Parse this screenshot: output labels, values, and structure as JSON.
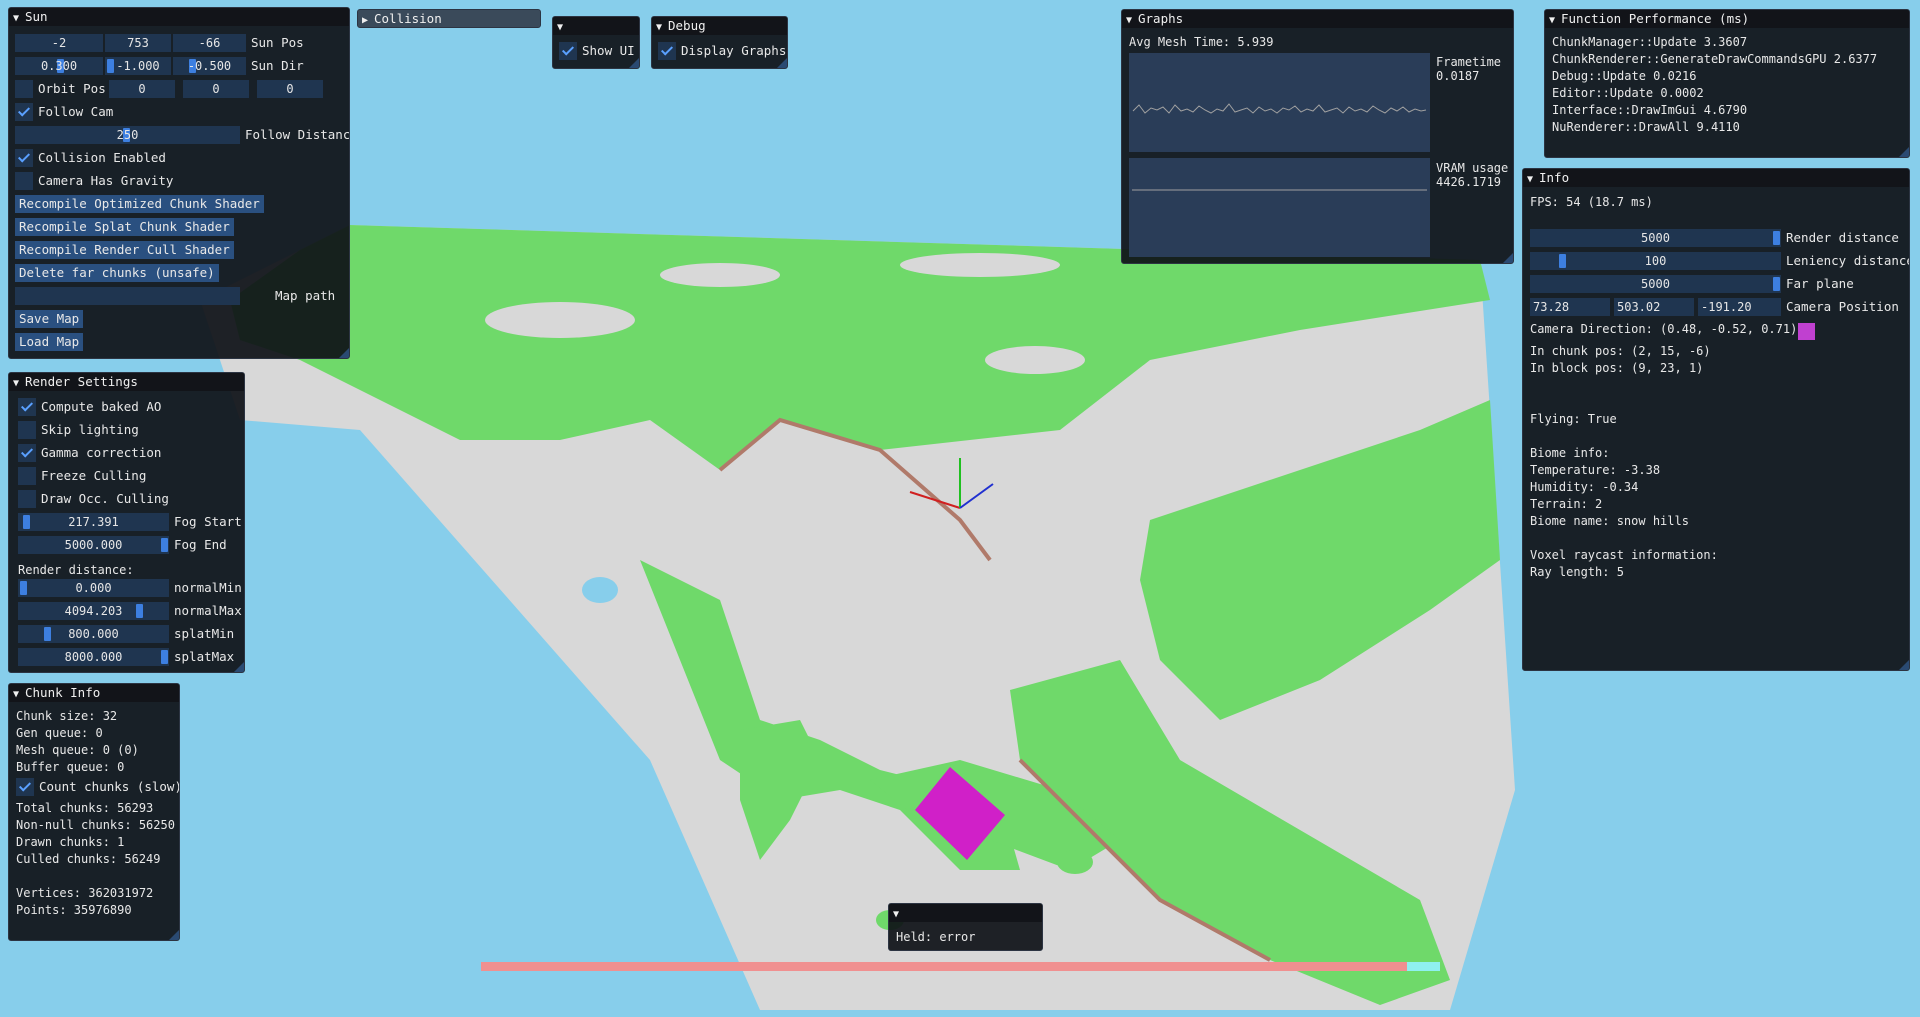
{
  "sun": {
    "title": "Sun",
    "pos": [
      "-2",
      "753",
      "-66"
    ],
    "pos_label": "Sun Pos",
    "dir": [
      "0.300",
      "-1.000",
      "-0.500"
    ],
    "dir_label": "Sun Dir",
    "orbit_label": "Orbit Pos",
    "orbit": [
      "0",
      "0",
      "0"
    ],
    "follow_cam": "Follow Cam",
    "follow_distance": "250",
    "follow_distance_label": "Follow Distance",
    "collision_enabled": "Collision Enabled",
    "camera_gravity": "Camera Has Gravity",
    "btn_opt_shader": "Recompile Optimized Chunk Shader",
    "btn_splat_shader": "Recompile Splat Chunk Shader",
    "btn_cull_shader": "Recompile Render Cull Shader",
    "btn_delete_far": "Delete far chunks (unsafe)",
    "map_path_label": "Map path",
    "map_path_value": "",
    "btn_save": "Save Map",
    "btn_load": "Load Map"
  },
  "collision": {
    "title": "Collision"
  },
  "ui_toggle": {
    "show_ui": "Show UI"
  },
  "debug": {
    "title": "Debug",
    "display_graphs": "Display Graphs"
  },
  "graphs": {
    "title": "Graphs",
    "avg_mesh": "Avg Mesh Time: 5.939",
    "frametime_label": "Frametime",
    "frametime_value": "0.0187",
    "vram_label": "VRAM usage",
    "vram_value": "4426.1719"
  },
  "perf": {
    "title": "Function Performance (ms)",
    "rows": [
      "ChunkManager::Update 3.3607",
      "ChunkRenderer::GenerateDrawCommandsGPU 2.6377",
      "Debug::Update      0.0216",
      "Editor::Update     0.0002",
      "Interface::DrawImGui 4.6790",
      "NuRenderer::DrawAll 9.4110"
    ]
  },
  "info": {
    "title": "Info",
    "fps": "FPS: 54 (18.7 ms)",
    "render_distance": "5000",
    "render_distance_label": "Render distance",
    "leniency": "100",
    "leniency_label": "Leniency distance",
    "far_plane": "5000",
    "far_plane_label": "Far plane",
    "cam_pos": [
      "73.28",
      "503.02",
      "-191.20"
    ],
    "cam_pos_label": "Camera Position",
    "cam_dir": "Camera Direction: (0.48, -0.52, 0.71)",
    "lines": [
      "In chunk pos: (2, 15, -6)",
      "In block pos: (9, 23, 1)",
      "",
      "",
      "Flying: True",
      "",
      "Biome info:",
      "Temperature: -3.38",
      "Humidity: -0.34",
      "Terrain: 2",
      "Biome name: snow hills",
      "",
      "Voxel raycast information:",
      "Ray length: 5"
    ]
  },
  "render": {
    "title": "Render Settings",
    "compute_ao": "Compute baked AO",
    "skip_lighting": "Skip lighting",
    "gamma": "Gamma correction",
    "freeze_culling": "Freeze Culling",
    "draw_occ": "Draw Occ. Culling",
    "fog_start": "217.391",
    "fog_start_label": "Fog Start",
    "fog_end": "5000.000",
    "fog_end_label": "Fog End",
    "render_distance_label": "Render distance:",
    "normal_min": "0.000",
    "normal_min_label": "normalMin",
    "normal_max": "4094.203",
    "normal_max_label": "normalMax",
    "splat_min": "800.000",
    "splat_min_label": "splatMin",
    "splat_max": "8000.000",
    "splat_max_label": "splatMax"
  },
  "chunk": {
    "title": "Chunk Info",
    "chunk_size": "Chunk size: 32",
    "gen_queue": "Gen queue:    0",
    "mesh_queue": "Mesh queue:   0    (0)",
    "buffer_queue": "Buffer queue: 0",
    "count_chunks": "Count chunks (slow)",
    "total": "Total chunks:    56293",
    "nonnull": "Non-null chunks: 56250",
    "drawn": "Drawn chunks:    1",
    "culled": "Culled chunks:   56249",
    "vertices": "Vertices: 362031972",
    "points": "Points:   35976890"
  },
  "held": {
    "text": "Held: error"
  },
  "colors": {
    "sky": "#87ceeb",
    "grass": "#6fd96a",
    "snow": "#d6d6d6",
    "dirt": "#b07a6a",
    "window_bg": "#0f1218",
    "frame_bg": "#1f3550",
    "button": "#2a5080",
    "accent": "#3d7fe0",
    "cube": "#d020c8"
  }
}
